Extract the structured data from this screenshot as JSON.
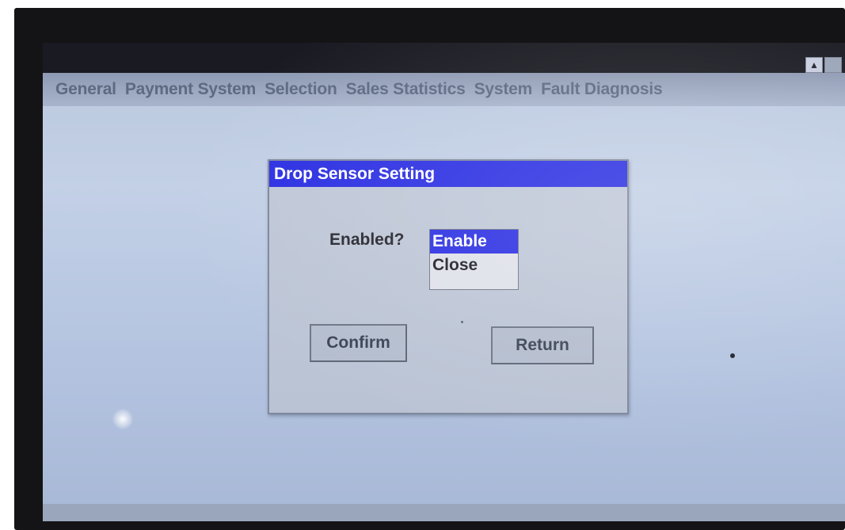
{
  "window": {
    "controls": [
      {
        "name": "scroll-up",
        "glyph": "▲"
      },
      {
        "name": "restore",
        "glyph": ""
      }
    ]
  },
  "menu": {
    "items": [
      "General",
      "Payment System",
      "Selection",
      "Sales Statistics",
      "System",
      "Fault Diagnosis"
    ]
  },
  "dialog": {
    "title": "Drop Sensor Setting",
    "field_label": "Enabled?",
    "options": [
      "Enable",
      "Close"
    ],
    "selected_option": "Enable",
    "confirm_label": "Confirm",
    "return_label": "Return"
  },
  "colors": {
    "accent": "#2b2fe2",
    "screen_background": "#b9c7dd",
    "title_bar": "#1a1b22"
  }
}
